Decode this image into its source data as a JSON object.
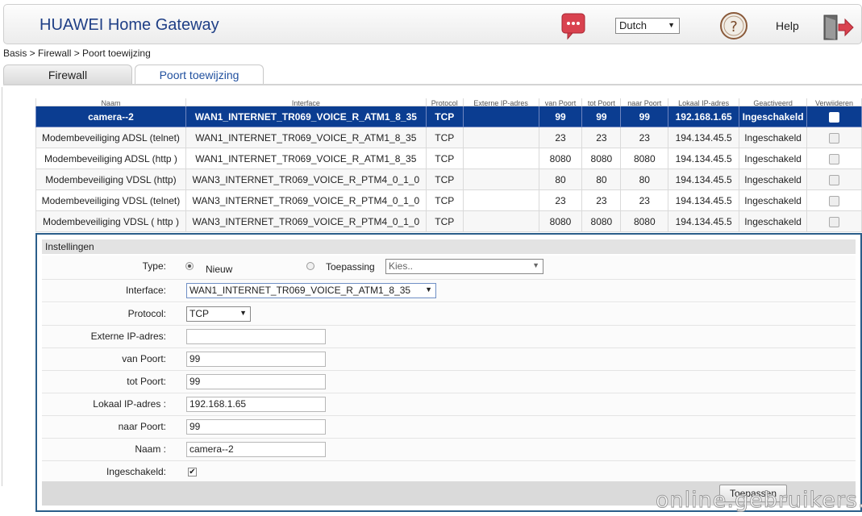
{
  "header": {
    "brand": "HUAWEI Home Gateway",
    "language": "Dutch",
    "help_label": "Help",
    "icons": [
      "message-icon",
      "help-icon",
      "logout-icon"
    ]
  },
  "breadcrumb": "Basis > Firewall > Poort toewijzing",
  "tabs": {
    "firewall": "Firewall",
    "poort": "Poort toewijzing"
  },
  "table": {
    "headers": [
      "Naam",
      "Interface",
      "Protocol",
      "Externe IP-adres",
      "van Poort",
      "tot Poort",
      "naar Poort",
      "Lokaal IP-adres",
      "Geactiveerd",
      "Verwijderen"
    ],
    "rows": [
      {
        "naam": "camera--2",
        "iface": "WAN1_INTERNET_TR069_VOICE_R_ATM1_8_35",
        "proto": "TCP",
        "ext": "",
        "van": "99",
        "tot": "99",
        "naar": "99",
        "lokaal": "192.168.1.65",
        "status": "Ingeschakeld"
      },
      {
        "naam": "Modembeveiliging ADSL (telnet)",
        "iface": "WAN1_INTERNET_TR069_VOICE_R_ATM1_8_35",
        "proto": "TCP",
        "ext": "",
        "van": "23",
        "tot": "23",
        "naar": "23",
        "lokaal": "194.134.45.5",
        "status": "Ingeschakeld"
      },
      {
        "naam": "Modembeveiliging ADSL (http )",
        "iface": "WAN1_INTERNET_TR069_VOICE_R_ATM1_8_35",
        "proto": "TCP",
        "ext": "",
        "van": "8080",
        "tot": "8080",
        "naar": "8080",
        "lokaal": "194.134.45.5",
        "status": "Ingeschakeld"
      },
      {
        "naam": "Modembeveiliging VDSL (http)",
        "iface": "WAN3_INTERNET_TR069_VOICE_R_PTM4_0_1_0",
        "proto": "TCP",
        "ext": "",
        "van": "80",
        "tot": "80",
        "naar": "80",
        "lokaal": "194.134.45.5",
        "status": "Ingeschakeld"
      },
      {
        "naam": "Modembeveiliging VDSL (telnet)",
        "iface": "WAN3_INTERNET_TR069_VOICE_R_PTM4_0_1_0",
        "proto": "TCP",
        "ext": "",
        "van": "23",
        "tot": "23",
        "naar": "23",
        "lokaal": "194.134.45.5",
        "status": "Ingeschakeld"
      },
      {
        "naam": "Modembeveiliging VDSL ( http )",
        "iface": "WAN3_INTERNET_TR069_VOICE_R_PTM4_0_1_0",
        "proto": "TCP",
        "ext": "",
        "van": "8080",
        "tot": "8080",
        "naar": "8080",
        "lokaal": "194.134.45.5",
        "status": "Ingeschakeld"
      }
    ]
  },
  "settings": {
    "title": "Instellingen",
    "type_label": "Type:",
    "type_new": "Nieuw",
    "type_app": "Toepassing",
    "app_placeholder": "Kies..",
    "interface_label": "Interface:",
    "interface_value": "WAN1_INTERNET_TR069_VOICE_R_ATM1_8_35",
    "protocol_label": "Protocol:",
    "protocol_value": "TCP",
    "ext_ip_label": "Externe IP-adres:",
    "ext_ip_value": "",
    "van_label": "van Poort:",
    "van_value": "99",
    "tot_label": "tot Poort:",
    "tot_value": "99",
    "lokaal_label": "Lokaal IP-adres :",
    "lokaal_value": "192.168.1.65",
    "naar_label": "naar Poort:",
    "naar_value": "99",
    "naam_label": "Naam :",
    "naam_value": "camera--2",
    "enabled_label": "Ingeschakeld:",
    "enabled": true,
    "apply_label": "Toepassen"
  },
  "watermark": "online.gebruikers.eu",
  "colors": {
    "brand": "#1f3f86",
    "selected_row": "#0b3d91",
    "panel_border": "#2a5e8a"
  }
}
